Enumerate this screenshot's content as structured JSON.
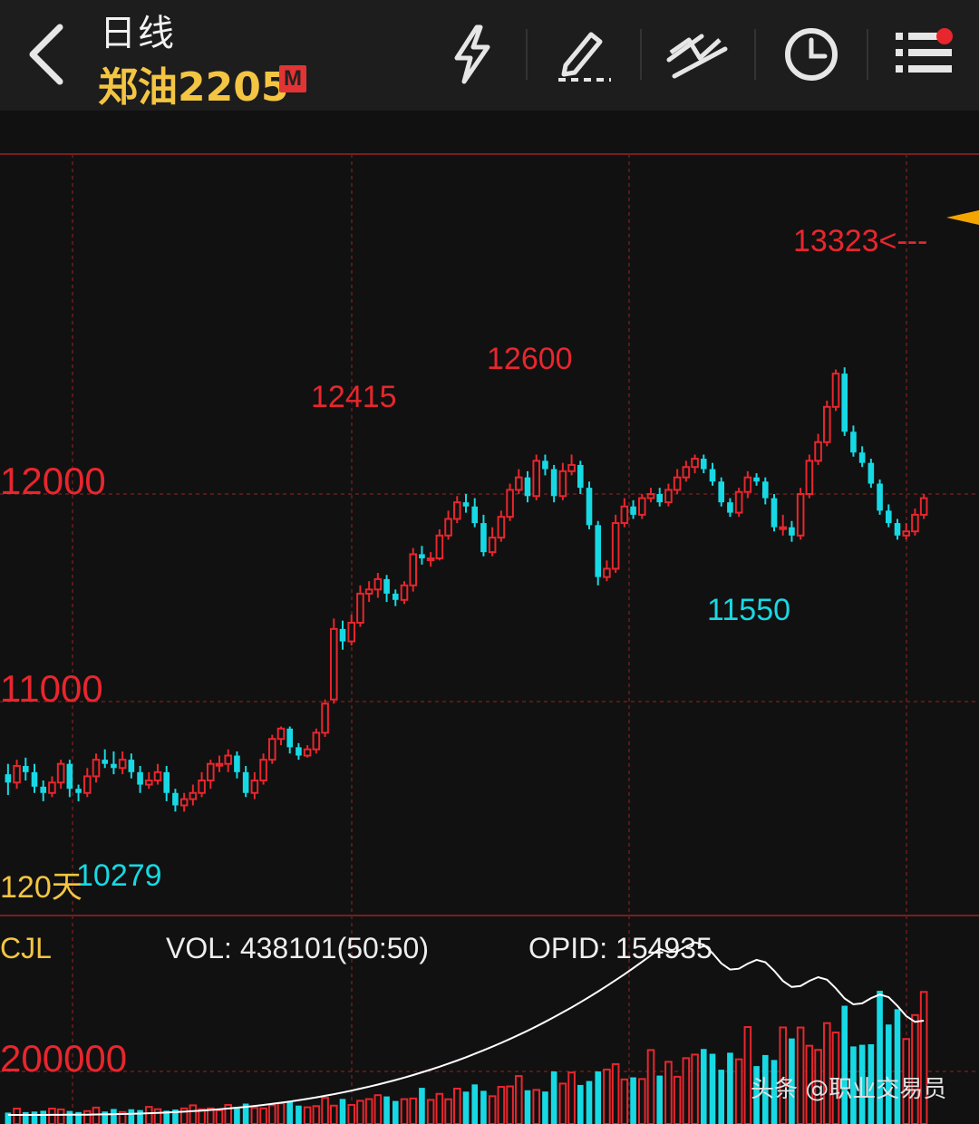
{
  "header": {
    "period": "日线",
    "symbol": "郑油2205",
    "badge": "M",
    "toolbar": [
      {
        "name": "flash-icon"
      },
      {
        "name": "draw-pen-icon"
      },
      {
        "name": "trend-line-icon"
      },
      {
        "name": "clock-icon"
      },
      {
        "name": "menu-list-icon",
        "notification_dot": true
      }
    ]
  },
  "colors": {
    "up": "#e8262d",
    "down": "#17d9e4",
    "grid": "#6b1d1d",
    "label_yellow": "#f4c542",
    "ma_line": "#ffffff",
    "current_marker": "#f5a500"
  },
  "price_labels": {
    "tick_12000": "12000",
    "tick_11000": "11000",
    "high_last": "13323<---",
    "high_12600": "12600",
    "high_12415": "12415",
    "low_11550": "11550",
    "low_10279": "10279",
    "period_count": "120天"
  },
  "volume_labels": {
    "indicator": "CJL",
    "vol": "VOL: 438101(50:50)",
    "opid": "OPID: 154935",
    "tick_200000": "200000"
  },
  "watermark": "头条 @职业交易员",
  "chart_data": {
    "type": "candlestick",
    "instrument": "郑油2205",
    "period": "日线",
    "count_label": "120天",
    "y_ticks": [
      11000,
      12000
    ],
    "ylim": [
      10200,
      13600
    ],
    "annotations": [
      {
        "label": "13323<---",
        "price": 13323
      },
      {
        "label": "12600",
        "price": 12600
      },
      {
        "label": "12415",
        "price": 12415
      },
      {
        "label": "11550",
        "price": 11550
      },
      {
        "label": "10279",
        "price": 10279
      }
    ],
    "candles": [
      [
        10650,
        10610,
        10700,
        10550
      ],
      [
        10610,
        10690,
        10720,
        10580
      ],
      [
        10690,
        10660,
        10730,
        10620
      ],
      [
        10660,
        10590,
        10700,
        10560
      ],
      [
        10590,
        10560,
        10620,
        10520
      ],
      [
        10560,
        10610,
        10640,
        10540
      ],
      [
        10610,
        10700,
        10720,
        10580
      ],
      [
        10700,
        10580,
        10720,
        10540
      ],
      [
        10580,
        10560,
        10600,
        10520
      ],
      [
        10560,
        10640,
        10680,
        10540
      ],
      [
        10640,
        10720,
        10750,
        10610
      ],
      [
        10720,
        10700,
        10770,
        10680
      ],
      [
        10700,
        10680,
        10760,
        10650
      ],
      [
        10680,
        10720,
        10760,
        10650
      ],
      [
        10720,
        10660,
        10750,
        10630
      ],
      [
        10660,
        10600,
        10690,
        10560
      ],
      [
        10600,
        10620,
        10660,
        10580
      ],
      [
        10620,
        10660,
        10700,
        10600
      ],
      [
        10660,
        10560,
        10690,
        10520
      ],
      [
        10560,
        10500,
        10580,
        10470
      ],
      [
        10500,
        10530,
        10560,
        10470
      ],
      [
        10530,
        10560,
        10600,
        10500
      ],
      [
        10560,
        10620,
        10660,
        10540
      ],
      [
        10620,
        10700,
        10720,
        10580
      ],
      [
        10700,
        10700,
        10740,
        10660
      ],
      [
        10700,
        10740,
        10770,
        10660
      ],
      [
        10740,
        10660,
        10760,
        10630
      ],
      [
        10660,
        10560,
        10690,
        10540
      ],
      [
        10560,
        10620,
        10660,
        10530
      ],
      [
        10620,
        10720,
        10750,
        10600
      ],
      [
        10720,
        10820,
        10840,
        10700
      ],
      [
        10820,
        10870,
        10880,
        10790
      ],
      [
        10870,
        10780,
        10880,
        10750
      ],
      [
        10780,
        10740,
        10800,
        10720
      ],
      [
        10740,
        10770,
        10790,
        10730
      ],
      [
        10770,
        10850,
        10870,
        10750
      ],
      [
        10850,
        10990,
        11010,
        10830
      ],
      [
        11010,
        11350,
        11400,
        10990
      ],
      [
        11350,
        11290,
        11390,
        11250
      ],
      [
        11290,
        11380,
        11420,
        11270
      ],
      [
        11380,
        11520,
        11560,
        11360
      ],
      [
        11520,
        11540,
        11580,
        11480
      ],
      [
        11540,
        11590,
        11620,
        11500
      ],
      [
        11590,
        11520,
        11610,
        11480
      ],
      [
        11520,
        11490,
        11540,
        11460
      ],
      [
        11490,
        11560,
        11580,
        11470
      ],
      [
        11560,
        11710,
        11740,
        11530
      ],
      [
        11710,
        11690,
        11750,
        11660
      ],
      [
        11690,
        11690,
        11720,
        11650
      ],
      [
        11690,
        11800,
        11830,
        11680
      ],
      [
        11800,
        11880,
        11920,
        11780
      ],
      [
        11880,
        11960,
        11990,
        11860
      ],
      [
        11960,
        11940,
        12000,
        11910
      ],
      [
        11940,
        11860,
        11980,
        11840
      ],
      [
        11860,
        11720,
        11900,
        11700
      ],
      [
        11720,
        11790,
        11840,
        11700
      ],
      [
        11790,
        11890,
        11920,
        11770
      ],
      [
        11890,
        12020,
        12050,
        11870
      ],
      [
        12020,
        12080,
        12120,
        12000
      ],
      [
        12080,
        11990,
        12110,
        11960
      ],
      [
        11990,
        12160,
        12190,
        11970
      ],
      [
        12160,
        12120,
        12190,
        12090
      ],
      [
        12120,
        11990,
        12140,
        11960
      ],
      [
        11990,
        12110,
        12150,
        11970
      ],
      [
        12110,
        12140,
        12190,
        12090
      ],
      [
        12140,
        12030,
        12160,
        12000
      ],
      [
        12030,
        11850,
        12060,
        11830
      ],
      [
        11850,
        11600,
        11870,
        11560
      ],
      [
        11600,
        11640,
        11680,
        11580
      ],
      [
        11640,
        11860,
        11900,
        11620
      ],
      [
        11860,
        11940,
        11980,
        11840
      ],
      [
        11940,
        11900,
        11970,
        11880
      ],
      [
        11900,
        11980,
        12000,
        11880
      ],
      [
        11980,
        12000,
        12030,
        11960
      ],
      [
        12000,
        11960,
        12030,
        11940
      ],
      [
        11960,
        12020,
        12050,
        11940
      ],
      [
        12020,
        12080,
        12120,
        12000
      ],
      [
        12080,
        12130,
        12160,
        12060
      ],
      [
        12130,
        12170,
        12190,
        12100
      ],
      [
        12170,
        12120,
        12190,
        12100
      ],
      [
        12120,
        12060,
        12150,
        12040
      ],
      [
        12060,
        11960,
        12080,
        11940
      ],
      [
        11960,
        11910,
        11980,
        11890
      ],
      [
        11910,
        12010,
        12030,
        11890
      ],
      [
        12010,
        12080,
        12110,
        11980
      ],
      [
        12080,
        12060,
        12100,
        12040
      ],
      [
        12060,
        11980,
        12080,
        11950
      ],
      [
        11980,
        11840,
        12000,
        11820
      ],
      [
        11840,
        11840,
        11900,
        11800
      ],
      [
        11840,
        11800,
        11870,
        11770
      ],
      [
        11800,
        12000,
        12030,
        11780
      ],
      [
        12000,
        12160,
        12190,
        11980
      ],
      [
        12160,
        12250,
        12290,
        12140
      ],
      [
        12250,
        12420,
        12450,
        12230
      ],
      [
        12420,
        12580,
        12600,
        12400
      ],
      [
        12580,
        12300,
        12610,
        12280
      ],
      [
        12300,
        12200,
        12330,
        12180
      ],
      [
        12200,
        12150,
        12230,
        12130
      ],
      [
        12150,
        12050,
        12170,
        12030
      ],
      [
        12050,
        11920,
        12070,
        11900
      ],
      [
        11920,
        11860,
        11950,
        11840
      ],
      [
        11860,
        11800,
        11880,
        11780
      ],
      [
        11800,
        11820,
        11860,
        11780
      ],
      [
        11820,
        11900,
        11930,
        11800
      ],
      [
        11900,
        11980,
        12000,
        11880
      ]
    ],
    "volume_panel": {
      "indicator": "CJL",
      "vol": 438101,
      "ratio": "50:50",
      "opid": 154935,
      "y_ticks": [
        200000
      ]
    }
  }
}
